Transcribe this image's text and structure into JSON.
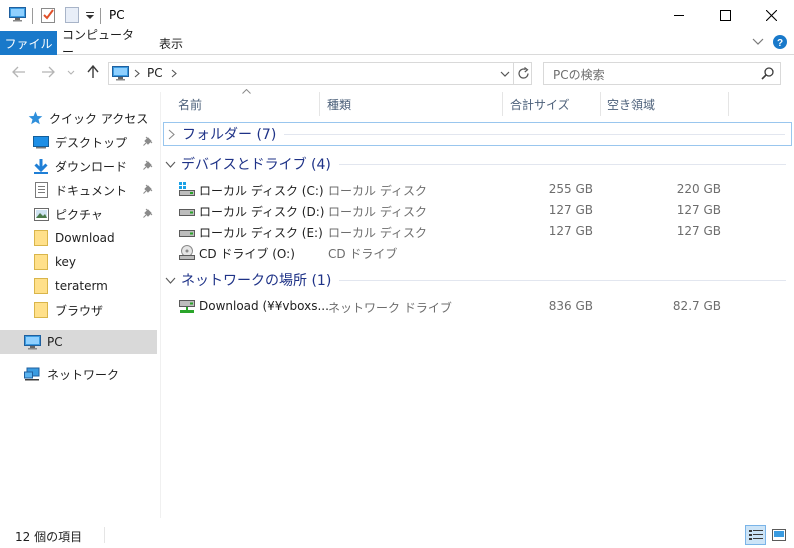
{
  "window": {
    "title": "PC",
    "quick_access_toolbar": [
      "computer-icon",
      "properties-check-icon",
      "new-folder-icon",
      "customize-dropdown-icon"
    ]
  },
  "ribbon": {
    "tabs": [
      {
        "label": "ファイル",
        "active": true
      },
      {
        "label": "コンピューター"
      },
      {
        "label": "表示"
      }
    ]
  },
  "address": {
    "path": [
      "PC"
    ],
    "search_placeholder": "PCの検索"
  },
  "nav": {
    "quick_access_label": "クイック アクセス",
    "quick_access_items": [
      {
        "label": "デスクトップ",
        "icon": "desktop-icon",
        "pinned": true
      },
      {
        "label": "ダウンロード",
        "icon": "download-arrow-icon",
        "pinned": true
      },
      {
        "label": "ドキュメント",
        "icon": "document-icon",
        "pinned": true
      },
      {
        "label": "ピクチャ",
        "icon": "picture-icon",
        "pinned": true
      },
      {
        "label": "Download",
        "icon": "folder-icon"
      },
      {
        "label": "key",
        "icon": "folder-icon"
      },
      {
        "label": "teraterm",
        "icon": "folder-icon"
      },
      {
        "label": "ブラウザ",
        "icon": "folder-icon"
      }
    ],
    "pc_label": "PC",
    "network_label": "ネットワーク"
  },
  "columns": [
    "名前",
    "種類",
    "合計サイズ",
    "空き領域"
  ],
  "groups": {
    "folders": {
      "label": "フォルダー (7)"
    },
    "devices": {
      "label": "デバイスとドライブ (4)",
      "items": [
        {
          "name": "ローカル ディスク (C:)",
          "type": "ローカル ディスク",
          "total": "255 GB",
          "free": "220 GB",
          "icon": "windows-drive-icon"
        },
        {
          "name": "ローカル ディスク (D:)",
          "type": "ローカル ディスク",
          "total": "127 GB",
          "free": "127 GB",
          "icon": "drive-icon"
        },
        {
          "name": "ローカル ディスク (E:)",
          "type": "ローカル ディスク",
          "total": "127 GB",
          "free": "127 GB",
          "icon": "drive-icon"
        },
        {
          "name": "CD ドライブ (O:)",
          "type": "CD ドライブ",
          "total": "",
          "free": "",
          "icon": "cd-drive-icon"
        }
      ]
    },
    "network": {
      "label": "ネットワークの場所 (1)",
      "items": [
        {
          "name": "Download (¥¥vboxs...",
          "type": "ネットワーク ドライブ",
          "total": "836 GB",
          "free": "82.7 GB",
          "icon": "network-drive-icon"
        }
      ]
    }
  },
  "status": {
    "item_count": "12 個の項目"
  },
  "colors": {
    "accent": "#1979ca",
    "group_text": "#1e3287",
    "selection": "#d9d9d9"
  }
}
